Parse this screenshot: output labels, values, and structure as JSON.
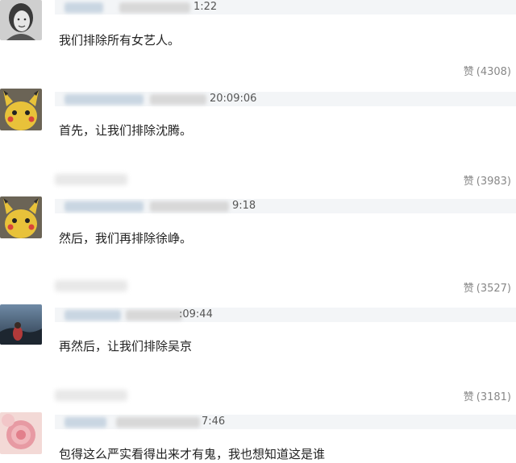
{
  "comments": [
    {
      "avatar": "vintage-portrait-woman",
      "time": "1:22",
      "text": "我们排除所有女艺人。",
      "like_label": "赞",
      "like_count": "(4308)"
    },
    {
      "avatar": "yellow-plush-character",
      "time": "20:09:06",
      "text": "首先，让我们排除沈腾。",
      "like_label": "赞",
      "like_count": "(3983)"
    },
    {
      "avatar": "yellow-plush-character",
      "time": "9:18",
      "text": "然后，我们再排除徐峥。",
      "like_label": "赞",
      "like_count": "(3527)"
    },
    {
      "avatar": "landscape-photo",
      "time": ":09:44",
      "text": "再然后，让我们排除吴京",
      "like_label": "赞",
      "like_count": "(3181)"
    },
    {
      "avatar": "pink-flower",
      "time": "7:46",
      "text": "包得这么严实看得出来才有鬼，我也想知道这是谁"
    }
  ],
  "colors": {
    "meta_bar": "#f3f5f7",
    "text": "#222222",
    "like": "#888888"
  }
}
